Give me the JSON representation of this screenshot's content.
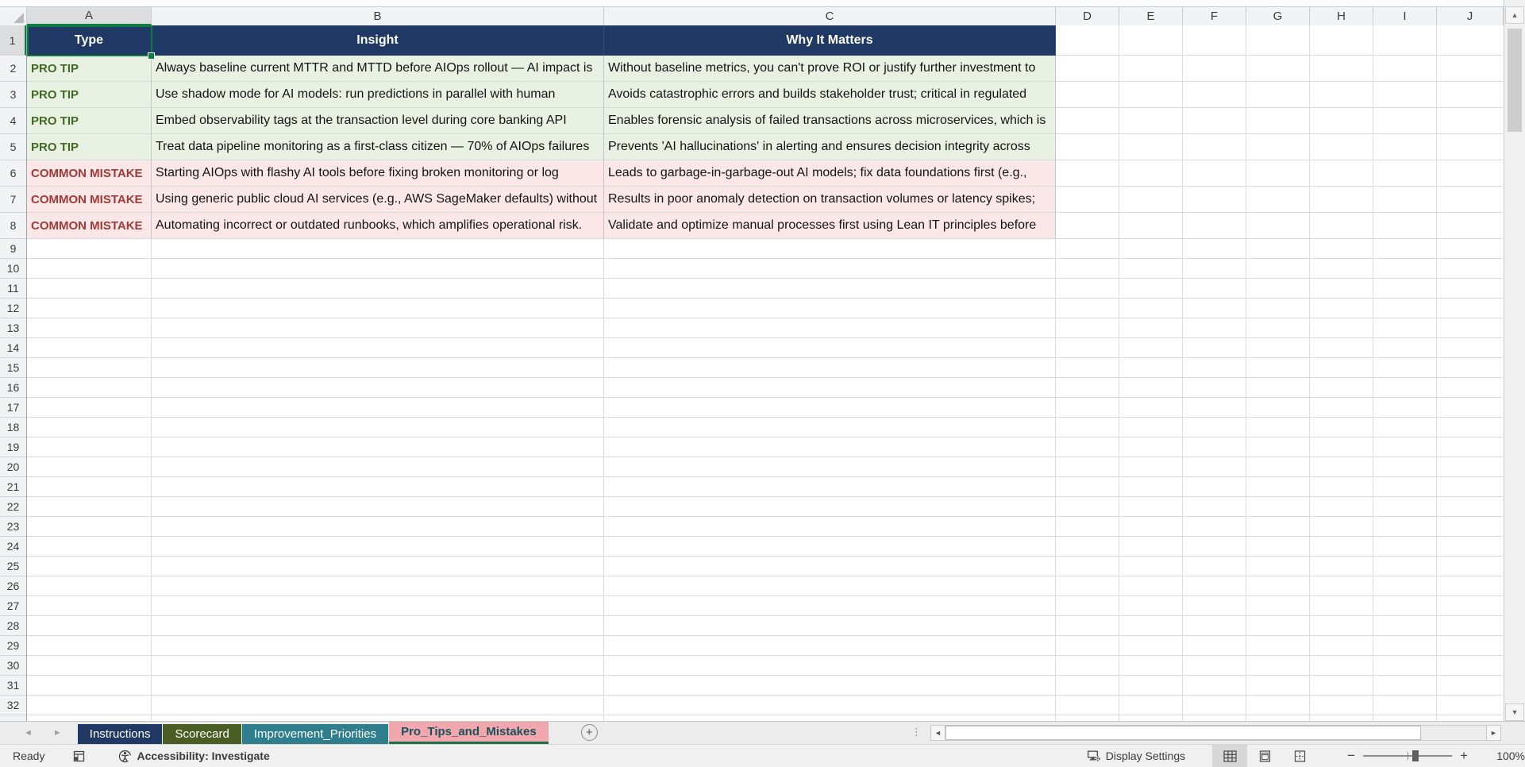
{
  "spreadsheet": {
    "column_headers": [
      "A",
      "B",
      "C",
      "D",
      "E",
      "F",
      "G",
      "H",
      "I",
      "J"
    ],
    "visible_rows": 32,
    "selected_cell": {
      "column": "A",
      "row": 1
    },
    "table": {
      "headers": [
        "Type",
        "Insight",
        "Why It Matters"
      ],
      "rows": [
        {
          "kind": "tip",
          "type": "PRO TIP",
          "insight": "Always baseline current MTTR and MTTD before AIOps rollout — AI impact is",
          "why": "Without baseline metrics, you can't prove ROI or justify further investment to"
        },
        {
          "kind": "tip",
          "type": "PRO TIP",
          "insight": "Use shadow mode for AI models: run predictions in parallel with human",
          "why": "Avoids catastrophic errors and builds stakeholder trust; critical in regulated"
        },
        {
          "kind": "tip",
          "type": "PRO TIP",
          "insight": "Embed observability tags at the transaction level during core banking API",
          "why": "Enables forensic analysis of failed transactions across microservices, which is"
        },
        {
          "kind": "tip",
          "type": "PRO TIP",
          "insight": "Treat data pipeline monitoring as a first-class citizen — 70% of AIOps failures",
          "why": "Prevents 'AI hallucinations' in alerting and ensures decision integrity across"
        },
        {
          "kind": "mistake",
          "type": "COMMON MISTAKE",
          "insight": "Starting AIOps with flashy AI tools before fixing broken monitoring or log",
          "why": "Leads to garbage-in-garbage-out AI models; fix data foundations first (e.g.,"
        },
        {
          "kind": "mistake",
          "type": "COMMON MISTAKE",
          "insight": "Using generic public cloud AI services (e.g., AWS SageMaker defaults) without",
          "why": "Results in poor anomaly detection on transaction volumes or latency spikes;"
        },
        {
          "kind": "mistake",
          "type": "COMMON MISTAKE",
          "insight": "Automating incorrect or outdated runbooks, which amplifies operational risk.",
          "why": "Validate and optimize manual processes first using Lean IT principles before"
        }
      ]
    }
  },
  "sheet_tabs": {
    "tabs": [
      {
        "label": "Instructions",
        "color": "#1F3864",
        "text_color": "#FFFFFF",
        "active": false
      },
      {
        "label": "Scorecard",
        "color": "#4A5D23",
        "text_color": "#FFFFFF",
        "active": false
      },
      {
        "label": "Improvement_Priorities",
        "color": "#2E7E8E",
        "text_color": "#FFFFFF",
        "active": false
      },
      {
        "label": "Pro_Tips_and_Mistakes",
        "color": "#F0A7AD",
        "text_color": "#1C515C",
        "active": true,
        "underline": "#1E7145"
      }
    ],
    "add_sheet_label": "+"
  },
  "status_bar": {
    "mode": "Ready",
    "accessibility": "Accessibility: Investigate",
    "display_settings": "Display Settings",
    "zoom_level": "100%"
  },
  "colors": {
    "table_header_fill": "#1F3864",
    "tip_fill": "#E9F1E3",
    "tip_text": "#3F6C22",
    "mistake_fill": "#FBE7E8",
    "mistake_text": "#A23B36",
    "selection_green": "#107C41"
  }
}
